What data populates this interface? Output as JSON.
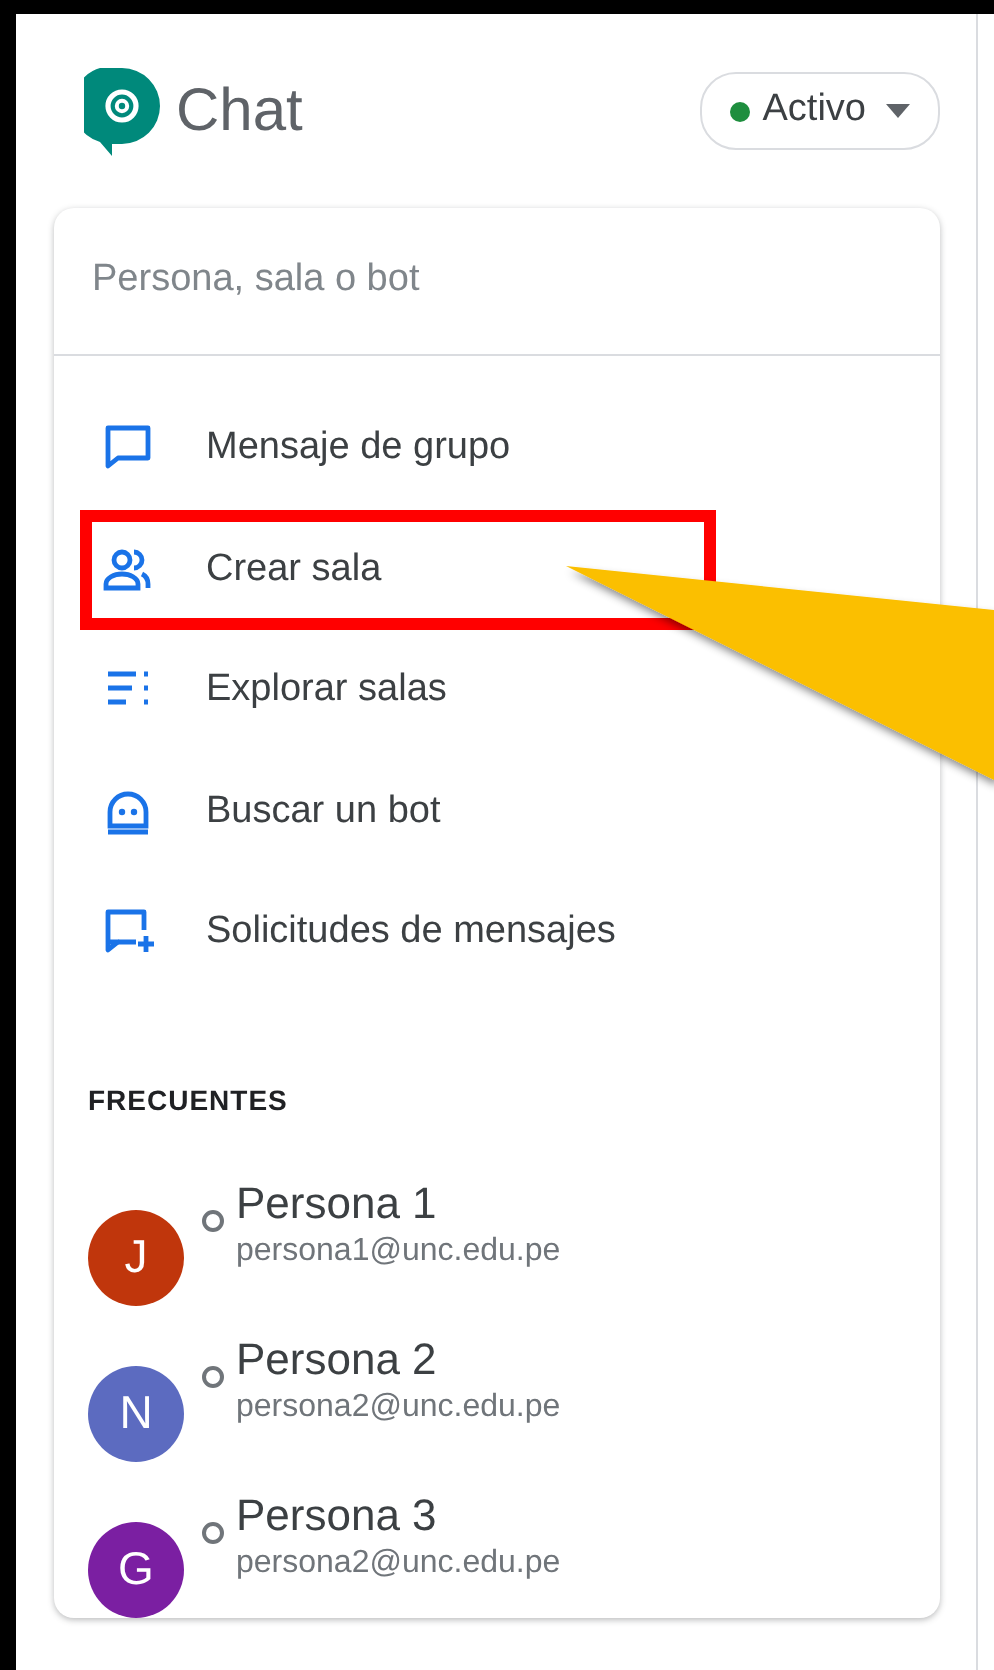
{
  "app": {
    "title": "Chat",
    "status": {
      "label": "Activo",
      "color": "#1e8e3e"
    }
  },
  "search": {
    "placeholder": "Persona, sala o bot"
  },
  "menu": [
    {
      "label": "Mensaje de grupo",
      "kind": "chat",
      "highlighted": false
    },
    {
      "label": "Crear sala",
      "kind": "people",
      "highlighted": true
    },
    {
      "label": "Explorar salas",
      "kind": "list",
      "highlighted": false
    },
    {
      "label": "Buscar un bot",
      "kind": "bot",
      "highlighted": false
    },
    {
      "label": "Solicitudes de mensajes",
      "kind": "chatplus",
      "highlighted": false
    }
  ],
  "section": "FRECUENTES",
  "contacts": [
    {
      "initial": "J",
      "color": "#c0360c",
      "name": "Persona 1",
      "email": "persona1@unc.edu.pe"
    },
    {
      "initial": "N",
      "color": "#5c6bc0",
      "name": "Persona 2",
      "email": "persona2@unc.edu.pe"
    },
    {
      "initial": "G",
      "color": "#7b1fa2",
      "name": "Persona 3",
      "email": "persona2@unc.edu.pe"
    }
  ]
}
